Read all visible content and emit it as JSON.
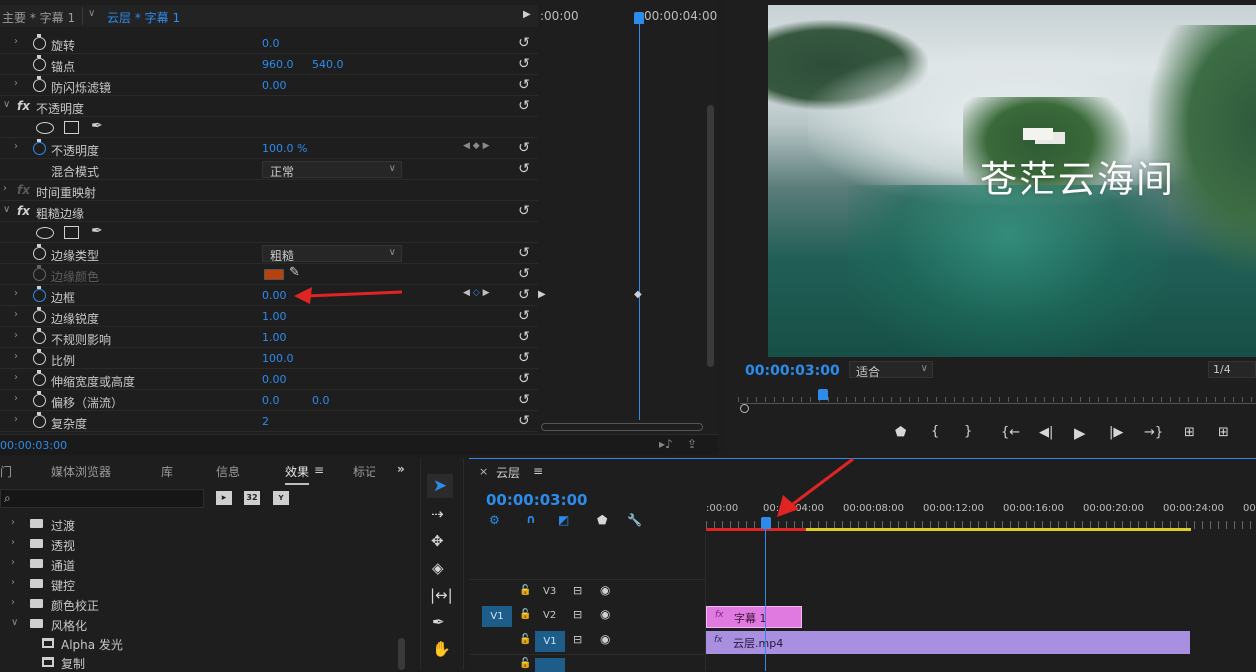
{
  "tabs": {
    "main_tab": "主要 * 字幕 1",
    "clip_tab": "云层 * 字幕 1"
  },
  "ec_timeline": {
    "t0": ":00:00",
    "t1": "00:00:04:00"
  },
  "props": [
    {
      "label": "旋转",
      "v1": "0.0",
      "v2": ""
    },
    {
      "label": "锚点",
      "v1": "960.0",
      "v2": "540.0"
    },
    {
      "label": "防闪烁滤镜",
      "v1": "0.00",
      "v2": ""
    }
  ],
  "opacity": {
    "fx": "fx",
    "title": "不透明度",
    "prop": "不透明度",
    "value": "100.0 %",
    "blend_label": "混合模式",
    "blend_value": "正常"
  },
  "time_remap": {
    "fx": "fx",
    "title": "时间重映射"
  },
  "rough": {
    "fx": "fx",
    "title": "粗糙边缘",
    "edge_type_label": "边缘类型",
    "edge_type_value": "粗糙",
    "edge_color_label": "边缘颜色",
    "edge_color": "#b8420f",
    "items": [
      {
        "label": "边框",
        "v1": "0.00",
        "v2": ""
      },
      {
        "label": "边缘锐度",
        "v1": "1.00",
        "v2": ""
      },
      {
        "label": "不规则影响",
        "v1": "1.00",
        "v2": ""
      },
      {
        "label": "比例",
        "v1": "100.0",
        "v2": ""
      },
      {
        "label": "伸缩宽度或高度",
        "v1": "0.00",
        "v2": ""
      },
      {
        "label": "偏移（湍流）",
        "v1": "0.0",
        "v2": "0.0"
      },
      {
        "label": "复杂度",
        "v1": "2",
        "v2": ""
      }
    ]
  },
  "ec_timecode": "00:00:03:00",
  "program": {
    "overlay_text": "苍茫云海间",
    "timecode": "00:00:03:00",
    "fit": "适合",
    "ratio": "1/4"
  },
  "project": {
    "tabs": [
      "门",
      "媒体浏览器",
      "库",
      "信息",
      "效果",
      "标记"
    ],
    "active_tab": "效果",
    "folders": [
      "过渡",
      "透视",
      "通道",
      "键控",
      "颜色校正",
      "风格化"
    ],
    "subitems": [
      "Alpha 发光",
      "复制"
    ]
  },
  "timeline": {
    "tab": "云层",
    "timecode": "00:00:03:00",
    "ruler": [
      ":00:00",
      "00:00:04:00",
      "00:00:08:00",
      "00:00:12:00",
      "00:00:16:00",
      "00:00:20:00",
      "00:00:24:00",
      "00:0"
    ],
    "tracks": [
      {
        "name": "V3"
      },
      {
        "name": "V2"
      },
      {
        "name": "V1"
      }
    ],
    "src_label": "V1",
    "clip_v2": "字幕 1",
    "clip_v1": "云层.mp4"
  },
  "colors": {
    "accent": "#2d8ceb",
    "clip_title": "#e07ae0",
    "clip_video": "#a98fe0",
    "red": "#e02424"
  }
}
